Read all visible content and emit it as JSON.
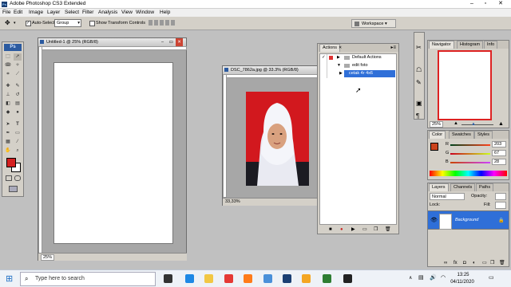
{
  "app": {
    "title": "Adobe Photoshop CS3 Extended",
    "logo": "Ps"
  },
  "menu": [
    "File",
    "Edit",
    "Image",
    "Layer",
    "Select",
    "Filter",
    "Analysis",
    "View",
    "Window",
    "Help"
  ],
  "options": {
    "auto_select_label": "Auto-Select:",
    "auto_select_value": "Group",
    "show_transform_label": "Show Transform Controls",
    "workspace_label": "Workspace"
  },
  "toolbox": {
    "logo": "Ps",
    "foreground_color": "#d42020",
    "background_color": "#ffffff"
  },
  "doc1": {
    "title": "Untitled-1 @ 25% (RGB/8)",
    "zoom": "25%"
  },
  "doc2": {
    "title": "DSC_7862a.jpg @ 33.3% (RGB/8)",
    "zoom": "33,33%"
  },
  "actions": {
    "tab": "Actions",
    "items": [
      {
        "label": "Default Actions"
      },
      {
        "label": "edit foto"
      },
      {
        "label": "cetak 4r 4x6",
        "selected": true
      }
    ]
  },
  "navigator": {
    "tabs": [
      "Navigator",
      "Histogram",
      "Info"
    ],
    "zoom": "25%"
  },
  "color": {
    "tabs": [
      "Color",
      "Swatches",
      "Styles"
    ],
    "r_label": "R",
    "g_label": "G",
    "b_label": "B",
    "r": "203",
    "g": "67",
    "b": "28",
    "swatch": "#cb431c"
  },
  "layers": {
    "tabs": [
      "Layers",
      "Channels",
      "Paths"
    ],
    "blend_mode": "Normal",
    "opacity_label": "Opacity:",
    "fill_label": "Fill:",
    "lock_label": "Lock:",
    "layer_name": "Background"
  },
  "taskbar": {
    "search_placeholder": "Type here to search",
    "time": "13:25",
    "date": "04/11/2020",
    "apps": [
      {
        "name": "task-view-icon",
        "color": "#333333"
      },
      {
        "name": "edge-icon",
        "color": "#1e88e5"
      },
      {
        "name": "file-explorer-icon",
        "color": "#f2c744"
      },
      {
        "name": "chrome-icon",
        "color": "#e53935"
      },
      {
        "name": "firefox-icon",
        "color": "#ff7b1a"
      },
      {
        "name": "app-icon",
        "color": "#4a90d9"
      },
      {
        "name": "photoshop-icon",
        "color": "#1b3f73"
      },
      {
        "name": "app2-icon",
        "color": "#f4a623"
      },
      {
        "name": "media-icon",
        "color": "#2e7d32"
      },
      {
        "name": "cmd-icon",
        "color": "#222222"
      }
    ]
  }
}
